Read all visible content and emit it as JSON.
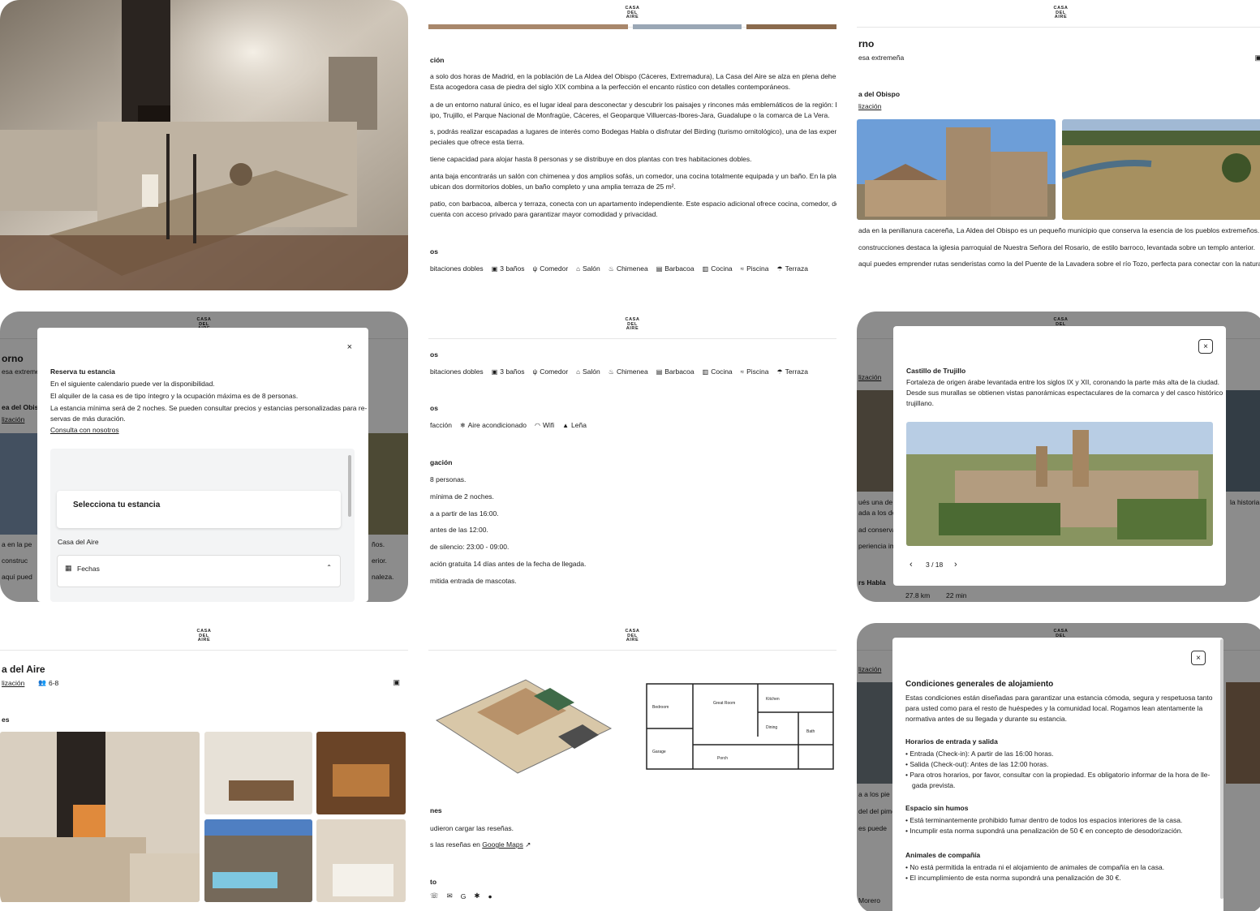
{
  "logo": "CASA DEL AIRE",
  "card2": {
    "heading": "ción",
    "paragraphs": [
      "a solo dos horas de Madrid, en la población de La Aldea del Obispo (Cáceres, Extremadura), La Casa del Aire se alza en plena dehesa",
      "Esta acogedora casa de piedra del siglo XIX combina a la perfección el encanto rústico con detalles contemporáneos.",
      "a de un entorno natural único, es el lugar ideal para desconectar y descubrir los paisajes y rincones más emblemáticos de la región: La",
      "ipo, Trujillo, el Parque Nacional de Monfragüe, Cáceres, el Geoparque Villuercas-Ibores-Jara, Guadalupe o la comarca de La Vera.",
      "s, podrás realizar escapadas a lugares de interés como Bodegas Habla o disfrutar del Birding (turismo ornitológico), una de las experien",
      "peciales que ofrece esta tierra.",
      "tiene capacidad para alojar hasta 8 personas y se distribuye en dos plantas con tres habitaciones dobles.",
      "anta baja encontrarás un salón con chimenea y dos amplios sofás, un comedor, una cocina totalmente equipada y un baño. En la planta",
      "ubican dos dormitorios dobles, un baño completo y una amplia terraza de 25 m².",
      "patio, con barbacoa, alberca y terraza, conecta con un apartamento independiente. Este espacio adicional ofrece cocina, comedor, dorm",
      "cuenta con acceso privado para garantizar mayor comodidad y privacidad."
    ],
    "section": "os",
    "amenities": [
      "bitaciones dobles",
      "3 baños",
      "Comedor",
      "Salón",
      "Chimenea",
      "Barbacoa",
      "Cocina",
      "Piscina",
      "Terraza"
    ]
  },
  "card3": {
    "title": "rno",
    "subtitle": "esa extremeña",
    "place": "a del Obispo",
    "link": "lización",
    "paragraphs": [
      "ada en la penillanura cacereña, La Aldea del Obispo es un pequeño municipio que conserva la esencia de los pueblos extremeños.",
      "construcciones destaca la iglesia parroquial de Nuestra Señora del Rosario, de estilo barroco, levantada sobre un templo anterior.",
      "aquí puedes emprender rutas senderistas como la del Puente de la Lavadera sobre el río Tozo, perfecta para conectar con la naturaleza."
    ]
  },
  "card4": {
    "bg_title": "orno",
    "bg_sub": "esa extreme",
    "bg_place": "ea del Obisp",
    "bg_link": "lización",
    "bg_lines": [
      "a en la pe",
      "construc",
      "aquí pued"
    ],
    "bg_right": [
      "ños.",
      "erior.",
      "naleza."
    ],
    "modal_title": "Reserva tu estancia",
    "modal_lines": [
      "En el siguiente calendario puede ver la disponibilidad.",
      "El alquiler de la casa es de tipo íntegro y la ocupación máxima es de 8 personas.",
      "La estancia mínima será de 2 noches. Se pueden consultar precios y estancias personalizadas para re-",
      "servas de más duración."
    ],
    "modal_link": "Consulta con nosotros",
    "select_label": "Selecciona tu estancia",
    "property": "Casa del Aire",
    "dates_label": "Fechas"
  },
  "card5": {
    "section1": "os",
    "amenities": [
      "bitaciones dobles",
      "3 baños",
      "Comedor",
      "Salón",
      "Chimenea",
      "Barbacoa",
      "Cocina",
      "Piscina",
      "Terraza"
    ],
    "section2": "os",
    "amenities2": [
      "facción",
      "Aire acondicionado",
      "Wifi",
      "Leña"
    ],
    "section3": "gación",
    "rules": [
      " 8 personas.",
      " mínima de 2 noches.",
      "a a partir de las 16:00.",
      "antes de las 12:00.",
      "de silencio: 23:00 - 09:00.",
      "ación gratuita 14 días antes de la fecha de llegada.",
      "mitida entrada de mascotas."
    ]
  },
  "card6": {
    "bg_link": "lización",
    "bg_lines": [
      "ués una de la",
      "ada a los de l",
      "ad conserva",
      "periencia im"
    ],
    "bg_right": [
      "la historia"
    ],
    "bg_place": "rs Habla",
    "bg_dist": "27.8 km",
    "bg_time": "22 min",
    "modal_title": "Castillo de Trujillo",
    "modal_lines": [
      "Fortaleza de origen árabe levantada entre los siglos IX y XII, coronando la parte más alta de la ciudad.",
      "Desde sus murallas se obtienen vistas panorámicas espectaculares de la comarca y del casco histórico",
      "trujillano."
    ],
    "counter": "3 / 18"
  },
  "card7": {
    "title": "a del Aire",
    "link": "lización",
    "capacity": "6-8",
    "section": "es"
  },
  "card8": {
    "section": "nes",
    "reviews_line1": "udieron cargar las reseñas.",
    "reviews_line2_pre": "s las reseñas en ",
    "reviews_link": "Google Maps",
    "contact": "to",
    "plan_labels": [
      "Great Room",
      "Kitchen",
      "Dining",
      "Bedroom",
      "Bath",
      "Porch",
      "Garage"
    ]
  },
  "card9": {
    "bg_link": "lización",
    "bg_lines": [
      "a a los pie",
      "del del piment",
      "es puede"
    ],
    "bg_bottom": "Morero",
    "modal_title": "Condiciones generales de alojamiento",
    "intro": [
      "Estas condiciones están diseñadas para garantizar una estancia cómoda, segura y respetuosa tanto",
      "para usted como para el resto de huéspedes y la comunidad local. Rogamos lean atentamente la",
      "normativa antes de su llegada y durante su estancia."
    ],
    "sections": [
      {
        "title": "Horarios de entrada y salida",
        "items": [
          "Entrada (Check-in): A partir de las 16:00 horas.",
          "Salida (Check-out): Antes de las 12:00 horas.",
          "Para otros horarios, por favor, consultar con la propiedad. Es obligatorio informar de la hora de lle-",
          "gada prevista."
        ]
      },
      {
        "title": "Espacio sin humos",
        "items": [
          "Está terminantemente prohibido fumar dentro de todos los espacios interiores de la casa.",
          "Incumplir esta norma supondrá una penalización de 50 € en concepto de desodorización."
        ]
      },
      {
        "title": "Animales de compañía",
        "items": [
          "No está permitida la entrada ni el alojamiento de animales de compañía en la casa.",
          "El incumplimiento de esta norma supondrá una penalización de 30 €."
        ]
      }
    ]
  },
  "colors": {
    "text": "#1b1b1b",
    "overlay": "rgba(0,0,0,0.45)",
    "stone": "#c9b79a",
    "sky": "#5c97d6"
  }
}
